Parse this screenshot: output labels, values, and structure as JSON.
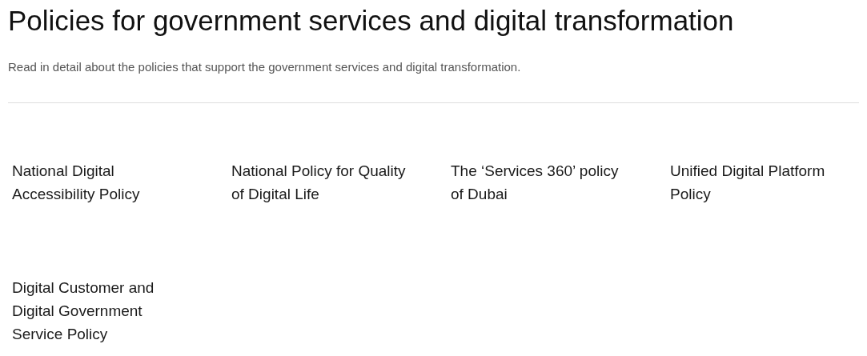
{
  "title": "Policies for government services and digital transformation",
  "subtitle": "Read in detail about the policies that support the government services and digital transformation.",
  "policies": [
    {
      "label": "National Digital Accessibility Policy"
    },
    {
      "label": "National Policy for Quality of Digital Life"
    },
    {
      "label": "The ‘Services 360’ policy of Dubai"
    },
    {
      "label": "Unified Digital Platform Policy"
    },
    {
      "label": "Digital Customer and Digital Government Service Policy"
    }
  ]
}
